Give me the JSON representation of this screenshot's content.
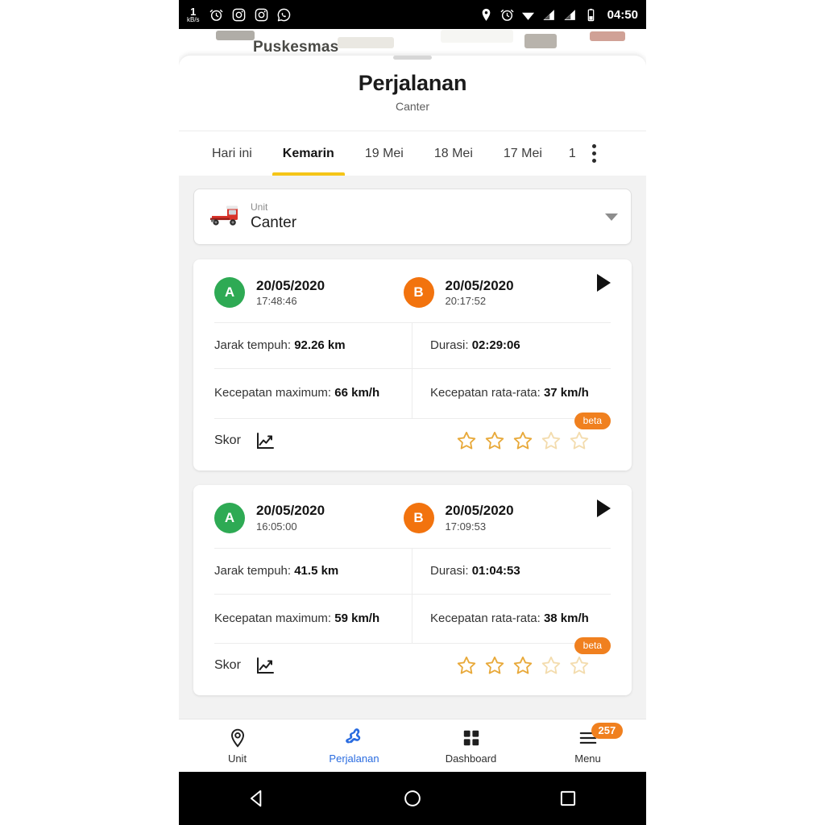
{
  "statusbar": {
    "network_speed_value": "1",
    "network_speed_unit": "kB/s",
    "clock": "04:50",
    "left_icons": [
      "alarm-icon",
      "instagram-icon",
      "instagram-icon",
      "whatsapp-icon"
    ],
    "right_icons": [
      "location-icon",
      "alarm-icon",
      "wifi-icon",
      "signal-icon",
      "signal-icon",
      "battery-icon"
    ]
  },
  "map": {
    "label": "Puskesmas"
  },
  "sheet": {
    "title": "Perjalanan",
    "subtitle": "Canter"
  },
  "tabs": {
    "items": [
      {
        "label": "Hari ini",
        "active": false
      },
      {
        "label": "Kemarin",
        "active": true
      },
      {
        "label": "19 Mei",
        "active": false
      },
      {
        "label": "18 Mei",
        "active": false
      },
      {
        "label": "17 Mei",
        "active": false
      },
      {
        "label": "1",
        "active": false
      }
    ],
    "overflow": "more-options"
  },
  "unit_selector": {
    "label": "Unit",
    "value": "Canter",
    "icon": "truck-icon",
    "caret": "chevron-down-icon"
  },
  "trips": [
    {
      "start": {
        "marker": "A",
        "date": "20/05/2020",
        "time": "17:48:46"
      },
      "end": {
        "marker": "B",
        "date": "20/05/2020",
        "time": "20:17:52"
      },
      "distance_label": "Jarak tempuh:",
      "distance_value": "92.26 km",
      "duration_label": "Durasi:",
      "duration_value": "02:29:06",
      "maxspeed_label": "Kecepatan maximum:",
      "maxspeed_value": "66 km/h",
      "avgspeed_label": "Kecepatan rata-rata:",
      "avgspeed_value": "37 km/h",
      "score_label": "Skor",
      "beta_badge": "beta",
      "stars_filled": 3,
      "stars_total": 5
    },
    {
      "start": {
        "marker": "A",
        "date": "20/05/2020",
        "time": "16:05:00"
      },
      "end": {
        "marker": "B",
        "date": "20/05/2020",
        "time": "17:09:53"
      },
      "distance_label": "Jarak tempuh:",
      "distance_value": "41.5 km",
      "duration_label": "Durasi:",
      "duration_value": "01:04:53",
      "maxspeed_label": "Kecepatan maximum:",
      "maxspeed_value": "59 km/h",
      "avgspeed_label": "Kecepatan rata-rata:",
      "avgspeed_value": "38 km/h",
      "score_label": "Skor",
      "beta_badge": "beta",
      "stars_filled": 3,
      "stars_total": 5
    }
  ],
  "bottom_nav": {
    "items": [
      {
        "label": "Unit",
        "icon": "location-pin-icon",
        "active": false
      },
      {
        "label": "Perjalanan",
        "icon": "route-icon",
        "active": true
      },
      {
        "label": "Dashboard",
        "icon": "grid-icon",
        "active": false
      },
      {
        "label": "Menu",
        "icon": "hamburger-icon",
        "active": false,
        "badge": "257"
      }
    ]
  },
  "android_nav": {
    "back": "back-triangle-icon",
    "home": "home-circle-icon",
    "recents": "recents-square-icon"
  },
  "colors": {
    "accent_blue": "#2a6ce0",
    "accent_orange": "#f0801f",
    "marker_a_green": "#2eaa54",
    "marker_b_orange": "#f2730e",
    "tab_underline_yellow": "#f5c518",
    "star_gold": "#e8a93a",
    "star_faded": "#f3dcae"
  }
}
